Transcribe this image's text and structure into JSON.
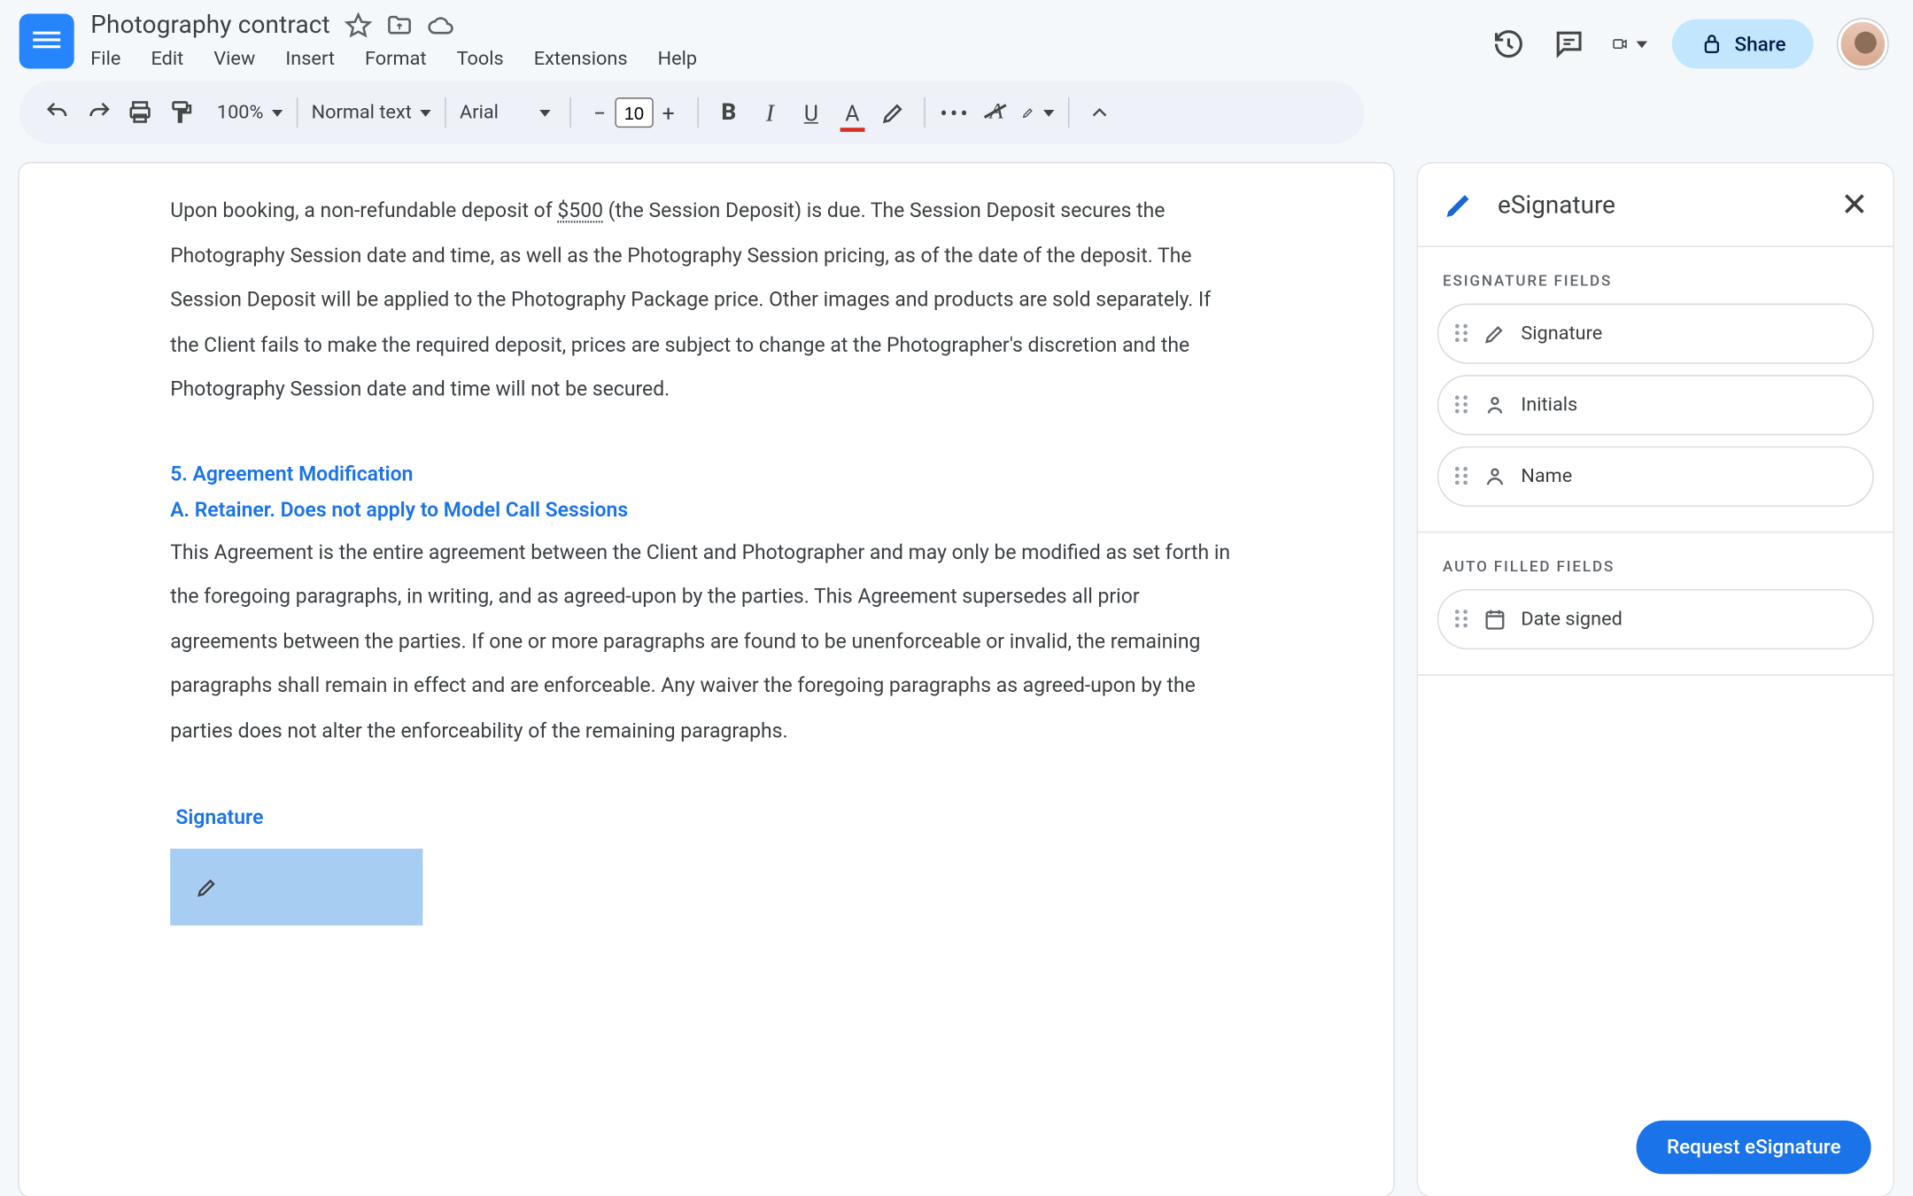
{
  "header": {
    "doc_title": "Photography contract",
    "menus": [
      "File",
      "Edit",
      "View",
      "Insert",
      "Format",
      "Tools",
      "Extensions",
      "Help"
    ],
    "share_label": "Share"
  },
  "toolbar": {
    "zoom": "100%",
    "style": "Normal text",
    "font": "Arial",
    "font_size": "10"
  },
  "document": {
    "para1_pre": "Upon booking, a non-refundable deposit of ",
    "para1_amount": "$500",
    "para1_post": " (the Session Deposit) is due. The Session Deposit secures the Photography Session date and time, as well as the Photography Session pricing, as of the date of the deposit. The Session Deposit will be applied to the Photography Package price. Other images and products are sold separately. If the Client fails to make the required deposit, prices are subject to change at the Photographer's discretion and the Photography Session date and time will not be secured.",
    "section5_heading": "5. Agreement Modification",
    "section5a_heading": "A. Retainer.  Does not apply to Model Call Sessions",
    "para2": "This Agreement is the entire agreement between the Client and Photographer and may only be modified as set forth in the foregoing paragraphs, in writing, and as agreed-upon by the parties.  This Agreement supersedes all prior agreements between the parties. If one or more paragraphs are found to be unenforceable or invalid, the remaining paragraphs shall remain in effect and are enforceable. Any waiver the foregoing paragraphs as agreed-upon by the parties does not alter the enforceability of the remaining paragraphs.",
    "signature_label": "Signature"
  },
  "sidepanel": {
    "title": "eSignature",
    "section1_label": "ESIGNATURE FIELDS",
    "fields": {
      "signature": "Signature",
      "initials": "Initials",
      "name": "Name"
    },
    "section2_label": "AUTO FILLED FIELDS",
    "auto_fields": {
      "date_signed": "Date signed"
    },
    "request_label": "Request eSignature"
  }
}
